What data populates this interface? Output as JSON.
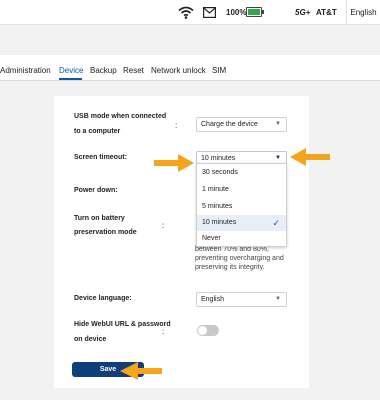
{
  "status_bar": {
    "battery_pct": "100%",
    "network": "5G+",
    "carrier": "AT&T",
    "language": "English"
  },
  "tabs": [
    "Administration",
    "Device",
    "Backup",
    "Reset",
    "Network unlock",
    "SIM"
  ],
  "form": {
    "usb_label_1": "USB mode when connected",
    "usb_label_2": "to a computer",
    "usb_value": "Charge the device",
    "screen_timeout_label": "Screen timeout:",
    "screen_timeout_value": "10 minutes",
    "power_down_label": "Power down:",
    "battery_label_1": "Turn on battery",
    "battery_label_2": "preservation mode",
    "battery_note": "between 70% and 80%, preventing overcharging and preserving its integrity.",
    "device_language_label": "Device language:",
    "device_language_value": "English",
    "hide_url_label_1": "Hide WebUI URL & password",
    "hide_url_label_2": "on device",
    "hide_url_enabled": false,
    "save_label": "Save",
    "colon": ":"
  },
  "dropdown": {
    "options": [
      "30 seconds",
      "1 minute",
      "5 minutes",
      "10 minutes",
      "Never"
    ],
    "selected": "10 minutes"
  },
  "colors": {
    "accent": "#0f57a8",
    "save": "#0f3e7a",
    "arrow": "#f5a51a"
  }
}
